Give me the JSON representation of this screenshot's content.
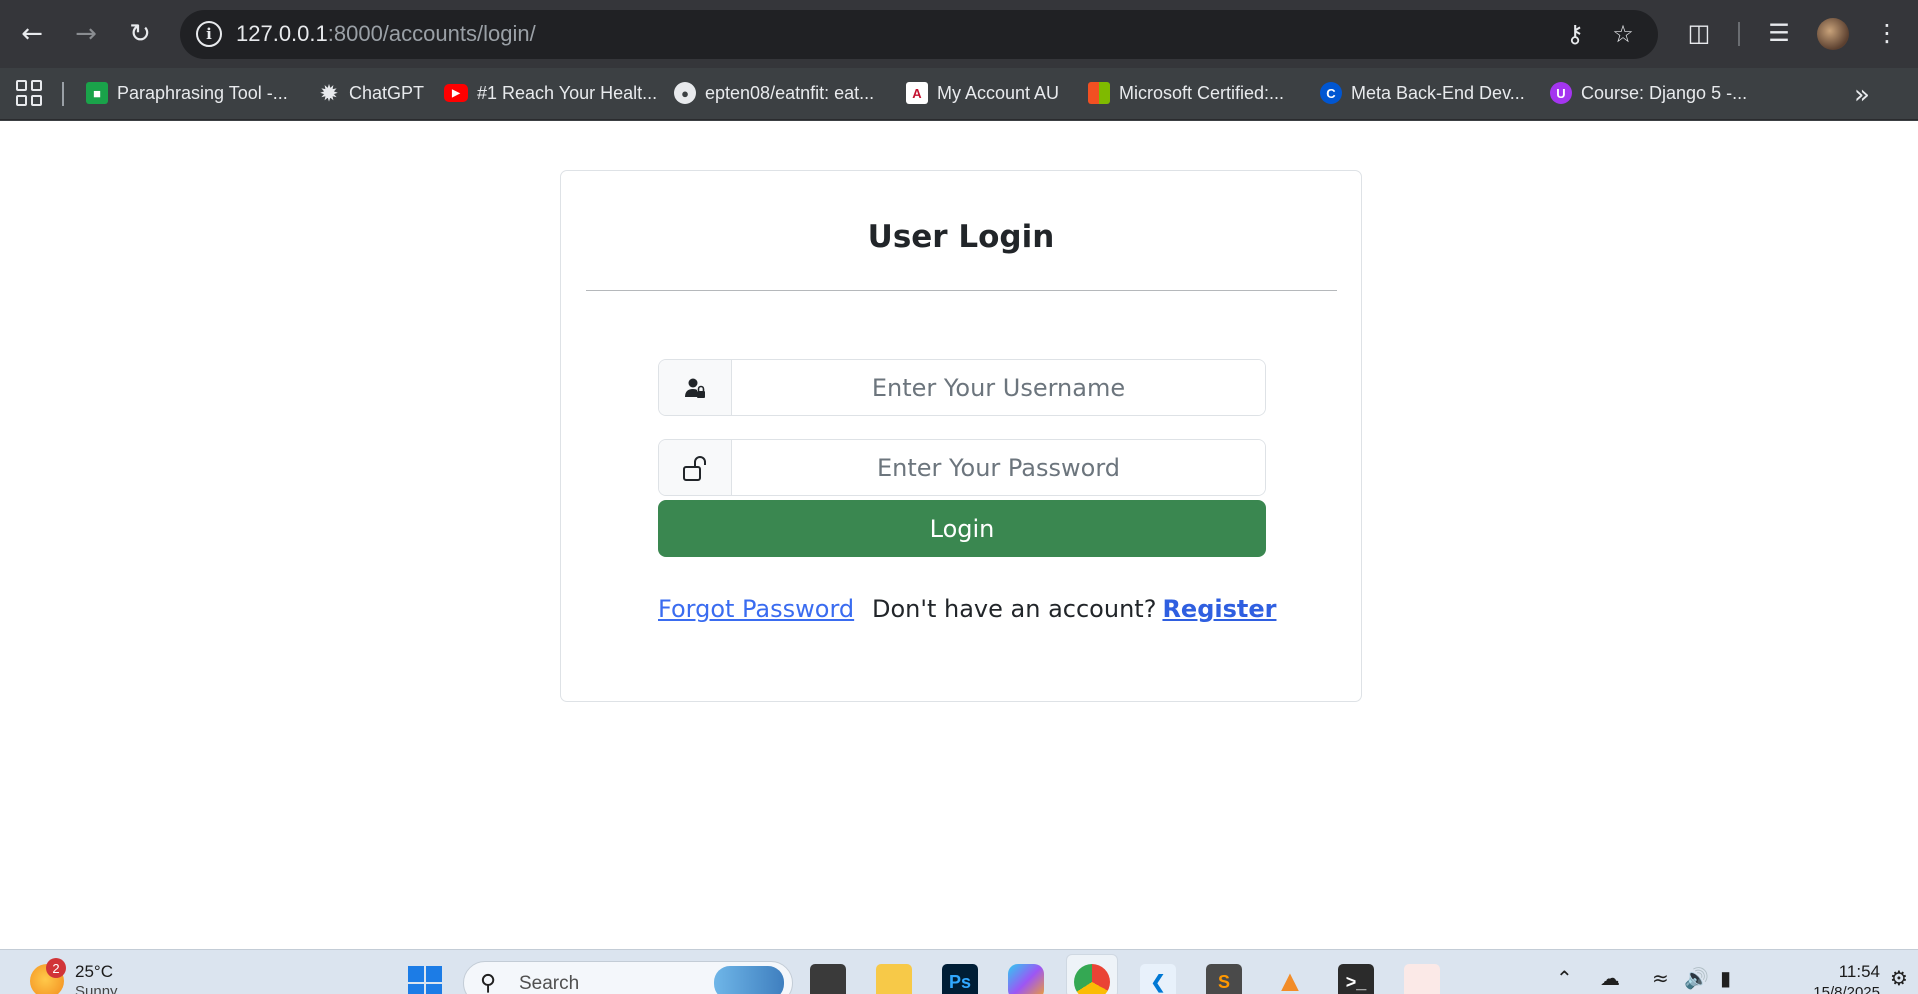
{
  "browser": {
    "url_host": "127.0.0.1",
    "url_path": ":8000/accounts/login/",
    "bookmarks": [
      {
        "label": "Paraphrasing Tool -...",
        "icon": "paraphrasing-tool-icon",
        "color": "#1aa34a"
      },
      {
        "label": "ChatGPT",
        "icon": "chatgpt-icon",
        "color": "#3c4043"
      },
      {
        "label": "#1 Reach Your Healt...",
        "icon": "youtube-icon",
        "color": "#ff0000"
      },
      {
        "label": "epten08/eatnfit: eat...",
        "icon": "github-icon",
        "color": "#ffffff"
      },
      {
        "label": "My Account AU",
        "icon": "au-icon",
        "color": "#ffffff"
      },
      {
        "label": "Microsoft Certified:...",
        "icon": "microsoft-icon",
        "color": "#f25022"
      },
      {
        "label": "Meta Back-End Dev...",
        "icon": "coursera-icon",
        "color": "#0056d2"
      },
      {
        "label": "Course: Django 5 -...",
        "icon": "udemy-icon",
        "color": "#a435f0"
      }
    ]
  },
  "login": {
    "title": "User Login",
    "username_placeholder": "Enter Your Username",
    "password_placeholder": "Enter Your Password",
    "login_label": "Login",
    "forgot_label": "Forgot Password",
    "no_account_text": "Don't have an account?",
    "register_label": "Register",
    "accent_color": "#3a8750",
    "link_color": "#3a6cf0"
  },
  "taskbar": {
    "temperature": "25°C",
    "condition": "Sunny",
    "weather_badge": "2",
    "search_label": "Search",
    "time": "11:54",
    "date": "15/8/2025"
  }
}
